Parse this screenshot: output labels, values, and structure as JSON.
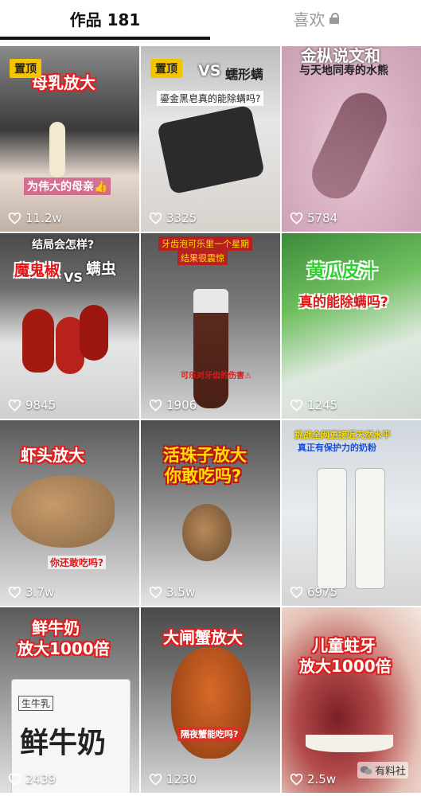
{
  "tabs": {
    "works_label": "作品 181",
    "likes_label": "喜欢"
  },
  "pin_label": "置顶",
  "watermark": "有料社",
  "tiles": [
    {
      "caption1": "母乳放大",
      "caption2": "为伟大的母亲👍",
      "likes": "11.2w",
      "pinned": true
    },
    {
      "caption1": "VS",
      "caption1b": "蠕形螨",
      "caption2": "鎏金黑皂真的能除螨吗?",
      "likes": "3325",
      "pinned": true
    },
    {
      "caption1": "金枞说文和",
      "caption2": "与天地同寿的水熊",
      "likes": "5784"
    },
    {
      "caption0": "结局会怎样?",
      "caption1": "魔鬼椒",
      "caption1b": "VS",
      "caption1c": "螨虫",
      "likes": "9845"
    },
    {
      "caption0": "牙齿泡可乐里一个星期",
      "caption0b": "结果很震惊",
      "caption2": "可乐对牙齿的伤害⚠",
      "likes": "1906"
    },
    {
      "caption1": "黄瓜皮汁",
      "caption2": "真的能除螨吗?",
      "likes": "1245"
    },
    {
      "caption1": "虾头放大",
      "caption2": "你还敢吃吗?",
      "likes": "3.7w"
    },
    {
      "caption1": "活珠子放大",
      "caption1b": "你敢吃吗?",
      "likes": "3.5w"
    },
    {
      "caption0": "挑战全网更接近天然水平",
      "caption0b": "真正有保护力的奶粉",
      "likes": "6975"
    },
    {
      "caption1": "鲜牛奶",
      "caption1b": "放大1000倍",
      "package_text": "鲜牛奶",
      "package_small": "生牛乳",
      "likes": "2439"
    },
    {
      "caption1": "大闸蟹放大",
      "caption2": "隔夜蟹能吃吗?",
      "likes": "1230"
    },
    {
      "caption1": "儿童蛀牙",
      "caption1b": "放大1000倍",
      "likes": "2.5w"
    }
  ]
}
